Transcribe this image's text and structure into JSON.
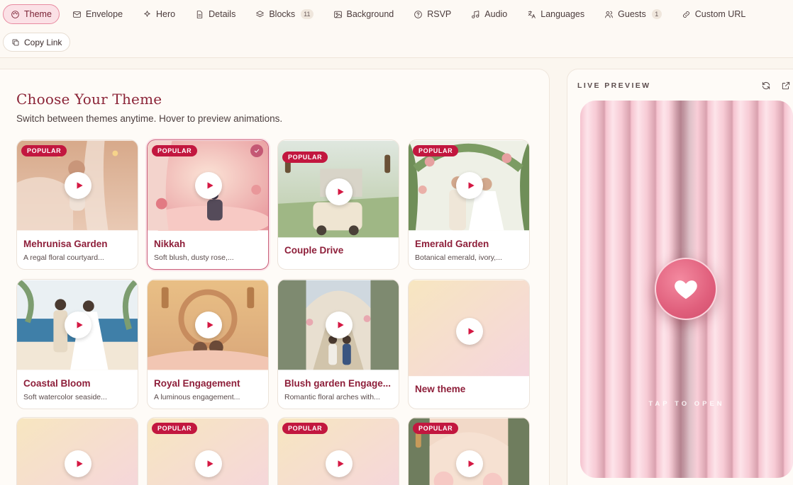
{
  "tabs": [
    {
      "label": "Theme",
      "icon": "palette-icon",
      "active": true
    },
    {
      "label": "Envelope",
      "icon": "mail-icon"
    },
    {
      "label": "Hero",
      "icon": "sparkles-icon"
    },
    {
      "label": "Details",
      "icon": "document-icon"
    },
    {
      "label": "Blocks",
      "icon": "layers-icon",
      "count": "11"
    },
    {
      "label": "Background",
      "icon": "image-icon"
    },
    {
      "label": "RSVP",
      "icon": "help-circle-icon"
    },
    {
      "label": "Audio",
      "icon": "music-icon"
    },
    {
      "label": "Languages",
      "icon": "translate-icon"
    },
    {
      "label": "Guests",
      "icon": "users-icon",
      "count": "1"
    },
    {
      "label": "Custom URL",
      "icon": "link-icon"
    }
  ],
  "copy_link": {
    "label": "Copy Link"
  },
  "main": {
    "title": "Choose Your Theme",
    "subtitle": "Switch between themes anytime. Hover to preview animations."
  },
  "themes": [
    {
      "name": "Mehrunisa Garden",
      "desc": "A regal floral courtyard...",
      "badge": "POPULAR"
    },
    {
      "name": "Nikkah",
      "desc": "Soft blush, dusty rose,...",
      "badge": "POPULAR",
      "selected": true
    },
    {
      "name": "Couple Drive",
      "desc": "",
      "badge": "POPULAR"
    },
    {
      "name": "Emerald Garden",
      "desc": "Botanical emerald, ivory,...",
      "badge": "POPULAR"
    },
    {
      "name": "Coastal Bloom",
      "desc": "Soft watercolor seaside...",
      "badge": ""
    },
    {
      "name": "Royal Engagement",
      "desc": "A luminous engagement...",
      "badge": ""
    },
    {
      "name": "Blush garden Engage...",
      "desc": "Romantic floral arches with...",
      "badge": ""
    },
    {
      "name": "New theme",
      "desc": "",
      "badge": ""
    },
    {
      "name": "",
      "desc": "",
      "badge": ""
    },
    {
      "name": "",
      "desc": "",
      "badge": "POPULAR"
    },
    {
      "name": "",
      "desc": "",
      "badge": "POPULAR"
    },
    {
      "name": "",
      "desc": "",
      "badge": "POPULAR"
    }
  ],
  "preview": {
    "label": "LIVE PREVIEW",
    "tap_text": "TAP TO OPEN",
    "refresh_icon": "refresh-icon",
    "external_icon": "external-link-icon",
    "accent": "#c2173f"
  }
}
